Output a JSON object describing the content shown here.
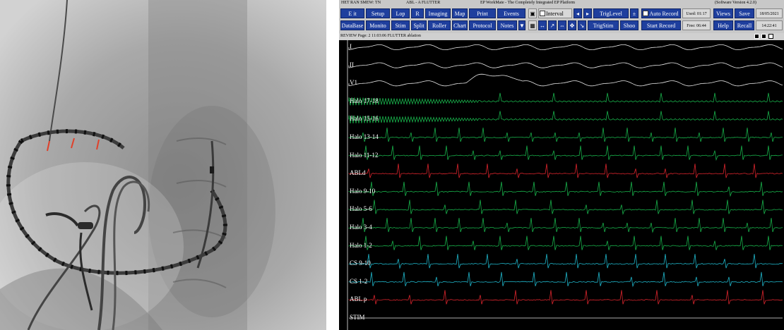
{
  "fluoroscopy": {
    "marker_color": "#e0402a"
  },
  "ep_system": {
    "header": {
      "patient": "HET RAN SMEW: TN",
      "case": "ABL - A FLUTTER",
      "product": "EP WorkMate - The Completely Integrated EP Platform",
      "version": "(Software Version 4.2.0)"
    },
    "toolbar": {
      "row1": [
        "E it",
        "Setup",
        "Lop",
        "R",
        "Imaging",
        "Map",
        "Print",
        "Events"
      ],
      "row2": [
        "DataBase",
        "Monito",
        "Stim",
        "Split",
        "Roller",
        "Chart",
        "Protocol",
        "Notes"
      ],
      "interval_label": "Interval",
      "triglevel_label": "TrigLevel",
      "trigstim_label": "TrigStim",
      "shoot_label": "Shoo",
      "auto_record": "Auto Record",
      "start_record": "Start Record",
      "used_label": "Used: 01:17",
      "free_label": "Free: 06:44",
      "views": "Views",
      "save": "Save",
      "help": "Help",
      "recall": "Recall",
      "date": "18/05/2021",
      "time": "14:22:41"
    },
    "review_bar": "REVIEW Page: 2    11:03:06   FLUTTER ablation",
    "channels": [
      {
        "label": "I",
        "color": "#e6e6e6"
      },
      {
        "label": "II",
        "color": "#e6e6e6"
      },
      {
        "label": "V1",
        "color": "#e6e6e6"
      },
      {
        "label": "Halo 17-18",
        "color": "#18b04a"
      },
      {
        "label": "Halo 15-16",
        "color": "#18b04a"
      },
      {
        "label": "Halo 13-14",
        "color": "#18b04a"
      },
      {
        "label": "Halo 11-12",
        "color": "#18b04a"
      },
      {
        "label": "ABLd",
        "color": "#d8242c"
      },
      {
        "label": "Halo 9-10",
        "color": "#18b04a"
      },
      {
        "label": "Halo 5-6",
        "color": "#18b04a"
      },
      {
        "label": "Halo 3-4",
        "color": "#18b04a"
      },
      {
        "label": "Halo 1-2",
        "color": "#18b04a"
      },
      {
        "label": "CS 9-10",
        "color": "#1fb4c8"
      },
      {
        "label": "CS 1-2",
        "color": "#1fb4c8"
      },
      {
        "label": "ABL p",
        "color": "#d8242c"
      },
      {
        "label": "STIM",
        "color": "#e6e6e6"
      }
    ]
  }
}
